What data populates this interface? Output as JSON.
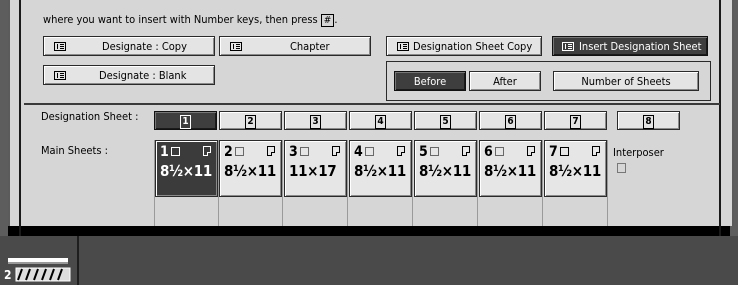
{
  "instruction": {
    "text_before": "where you want to insert with Number keys, then press ",
    "key": "#",
    "text_after": "."
  },
  "top_buttons": {
    "designate_copy": "Designate : Copy",
    "chapter": "Chapter",
    "designation_sheet_copy": "Designation Sheet Copy",
    "insert_designation_sheet": "Insert Designation Sheet",
    "designate_blank": "Designate : Blank"
  },
  "position": {
    "before": "Before",
    "after": "After",
    "number_of_sheets": "Number of Sheets"
  },
  "designation_sheet": {
    "label": "Designation Sheet :",
    "numbers": [
      "1",
      "2",
      "3",
      "4",
      "5",
      "6",
      "7",
      "8"
    ],
    "selected": "1"
  },
  "main_sheets": {
    "label": "Main Sheets :",
    "cards": [
      {
        "num": "1",
        "size": "8½×11"
      },
      {
        "num": "2",
        "size": "8½×11"
      },
      {
        "num": "3",
        "size": "11×17"
      },
      {
        "num": "4",
        "size": "8½×11"
      },
      {
        "num": "5",
        "size": "8½×11"
      },
      {
        "num": "6",
        "size": "8½×11"
      },
      {
        "num": "7",
        "size": "8½×11"
      }
    ]
  },
  "interposer_label": "Interposer",
  "tray": {
    "number": "2"
  },
  "colors": {
    "selected": "#3e3e3e",
    "panel": "#d6d6d6",
    "button": "#e4e4e4"
  }
}
